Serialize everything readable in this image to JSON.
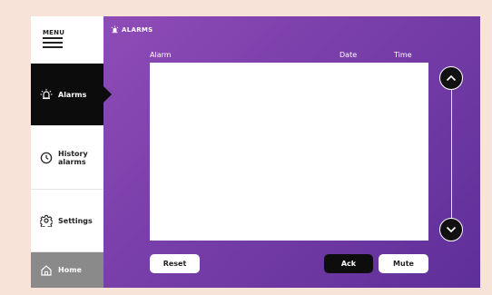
{
  "sidebar": {
    "menu_label": "MENU",
    "items": [
      {
        "label": "Alarms",
        "icon": "siren-icon"
      },
      {
        "label": "History alarms",
        "icon": "clock-icon"
      },
      {
        "label": "Settings",
        "icon": "gear-icon"
      },
      {
        "label": "Home",
        "icon": "home-icon"
      }
    ]
  },
  "main": {
    "title": "ALARMS",
    "columns": [
      "Alarm",
      "Date",
      "Time"
    ],
    "buttons": {
      "reset": "Reset",
      "ack": "Ack",
      "mute": "Mute"
    }
  },
  "colors": {
    "panel_gradient_start": "#8f4cb7",
    "panel_gradient_end": "#5f2f99",
    "active_item": "#0c0c0c",
    "home_item": "#8a8a8a"
  }
}
